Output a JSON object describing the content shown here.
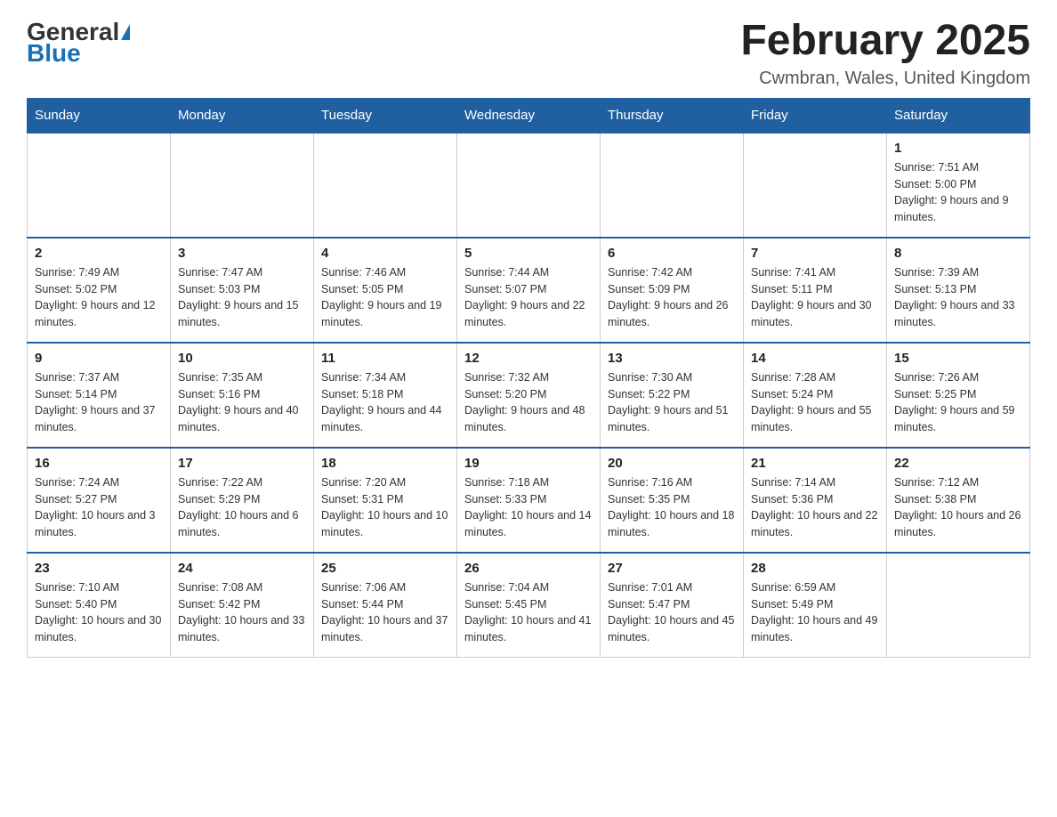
{
  "header": {
    "logo_general": "General",
    "logo_blue": "Blue",
    "title": "February 2025",
    "location": "Cwmbran, Wales, United Kingdom"
  },
  "weekdays": [
    "Sunday",
    "Monday",
    "Tuesday",
    "Wednesday",
    "Thursday",
    "Friday",
    "Saturday"
  ],
  "weeks": [
    [
      {
        "day": "",
        "info": ""
      },
      {
        "day": "",
        "info": ""
      },
      {
        "day": "",
        "info": ""
      },
      {
        "day": "",
        "info": ""
      },
      {
        "day": "",
        "info": ""
      },
      {
        "day": "",
        "info": ""
      },
      {
        "day": "1",
        "info": "Sunrise: 7:51 AM\nSunset: 5:00 PM\nDaylight: 9 hours and 9 minutes."
      }
    ],
    [
      {
        "day": "2",
        "info": "Sunrise: 7:49 AM\nSunset: 5:02 PM\nDaylight: 9 hours and 12 minutes."
      },
      {
        "day": "3",
        "info": "Sunrise: 7:47 AM\nSunset: 5:03 PM\nDaylight: 9 hours and 15 minutes."
      },
      {
        "day": "4",
        "info": "Sunrise: 7:46 AM\nSunset: 5:05 PM\nDaylight: 9 hours and 19 minutes."
      },
      {
        "day": "5",
        "info": "Sunrise: 7:44 AM\nSunset: 5:07 PM\nDaylight: 9 hours and 22 minutes."
      },
      {
        "day": "6",
        "info": "Sunrise: 7:42 AM\nSunset: 5:09 PM\nDaylight: 9 hours and 26 minutes."
      },
      {
        "day": "7",
        "info": "Sunrise: 7:41 AM\nSunset: 5:11 PM\nDaylight: 9 hours and 30 minutes."
      },
      {
        "day": "8",
        "info": "Sunrise: 7:39 AM\nSunset: 5:13 PM\nDaylight: 9 hours and 33 minutes."
      }
    ],
    [
      {
        "day": "9",
        "info": "Sunrise: 7:37 AM\nSunset: 5:14 PM\nDaylight: 9 hours and 37 minutes."
      },
      {
        "day": "10",
        "info": "Sunrise: 7:35 AM\nSunset: 5:16 PM\nDaylight: 9 hours and 40 minutes."
      },
      {
        "day": "11",
        "info": "Sunrise: 7:34 AM\nSunset: 5:18 PM\nDaylight: 9 hours and 44 minutes."
      },
      {
        "day": "12",
        "info": "Sunrise: 7:32 AM\nSunset: 5:20 PM\nDaylight: 9 hours and 48 minutes."
      },
      {
        "day": "13",
        "info": "Sunrise: 7:30 AM\nSunset: 5:22 PM\nDaylight: 9 hours and 51 minutes."
      },
      {
        "day": "14",
        "info": "Sunrise: 7:28 AM\nSunset: 5:24 PM\nDaylight: 9 hours and 55 minutes."
      },
      {
        "day": "15",
        "info": "Sunrise: 7:26 AM\nSunset: 5:25 PM\nDaylight: 9 hours and 59 minutes."
      }
    ],
    [
      {
        "day": "16",
        "info": "Sunrise: 7:24 AM\nSunset: 5:27 PM\nDaylight: 10 hours and 3 minutes."
      },
      {
        "day": "17",
        "info": "Sunrise: 7:22 AM\nSunset: 5:29 PM\nDaylight: 10 hours and 6 minutes."
      },
      {
        "day": "18",
        "info": "Sunrise: 7:20 AM\nSunset: 5:31 PM\nDaylight: 10 hours and 10 minutes."
      },
      {
        "day": "19",
        "info": "Sunrise: 7:18 AM\nSunset: 5:33 PM\nDaylight: 10 hours and 14 minutes."
      },
      {
        "day": "20",
        "info": "Sunrise: 7:16 AM\nSunset: 5:35 PM\nDaylight: 10 hours and 18 minutes."
      },
      {
        "day": "21",
        "info": "Sunrise: 7:14 AM\nSunset: 5:36 PM\nDaylight: 10 hours and 22 minutes."
      },
      {
        "day": "22",
        "info": "Sunrise: 7:12 AM\nSunset: 5:38 PM\nDaylight: 10 hours and 26 minutes."
      }
    ],
    [
      {
        "day": "23",
        "info": "Sunrise: 7:10 AM\nSunset: 5:40 PM\nDaylight: 10 hours and 30 minutes."
      },
      {
        "day": "24",
        "info": "Sunrise: 7:08 AM\nSunset: 5:42 PM\nDaylight: 10 hours and 33 minutes."
      },
      {
        "day": "25",
        "info": "Sunrise: 7:06 AM\nSunset: 5:44 PM\nDaylight: 10 hours and 37 minutes."
      },
      {
        "day": "26",
        "info": "Sunrise: 7:04 AM\nSunset: 5:45 PM\nDaylight: 10 hours and 41 minutes."
      },
      {
        "day": "27",
        "info": "Sunrise: 7:01 AM\nSunset: 5:47 PM\nDaylight: 10 hours and 45 minutes."
      },
      {
        "day": "28",
        "info": "Sunrise: 6:59 AM\nSunset: 5:49 PM\nDaylight: 10 hours and 49 minutes."
      },
      {
        "day": "",
        "info": ""
      }
    ]
  ]
}
